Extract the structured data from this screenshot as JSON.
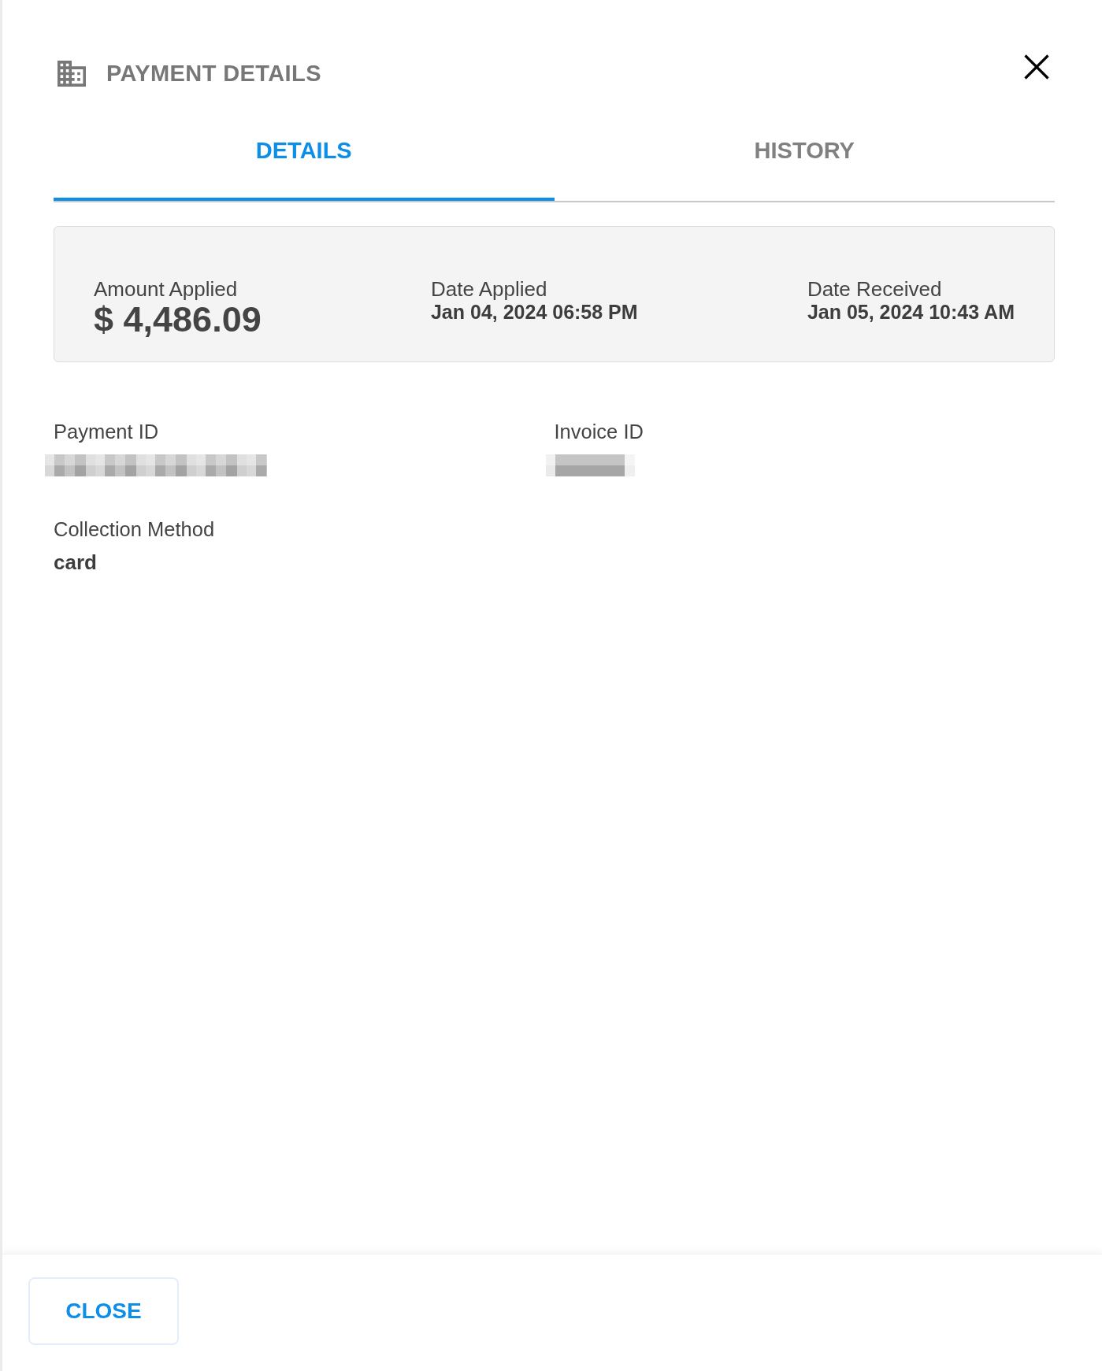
{
  "panel": {
    "title": "PAYMENT DETAILS"
  },
  "tabs": [
    {
      "label": "DETAILS",
      "selected": true
    },
    {
      "label": "HISTORY",
      "selected": false
    }
  ],
  "summary": [
    {
      "kind": "amount",
      "label": "Amount Applied",
      "value": "$ 4,486.09"
    },
    {
      "kind": "date",
      "label": "Date Applied",
      "value": "Jan 04, 2024 06:58 PM"
    },
    {
      "kind": "date",
      "label": "Date Received",
      "value": "Jan 05, 2024 10:43 AM"
    }
  ],
  "fields": [
    {
      "kind": "long",
      "label": "Payment ID"
    },
    {
      "kind": "short",
      "label": "Invoice ID"
    },
    {
      "kind": "text",
      "label": "Collection Method",
      "value": "card"
    }
  ],
  "footer": {
    "buttons": [
      "CLOSE"
    ]
  }
}
